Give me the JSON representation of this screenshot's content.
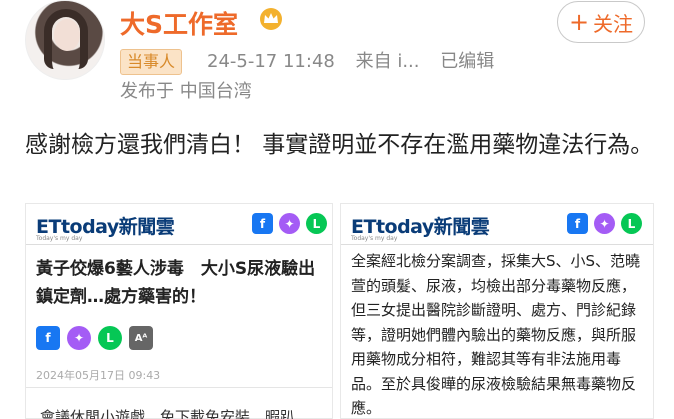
{
  "profile": {
    "username": "大S工作室",
    "follow_label": "关注",
    "badge": "当事人",
    "timestamp": "24-5-17 11:48",
    "source": "来自 i...",
    "edited": "已编辑",
    "location": "发布于 中国台湾"
  },
  "post": {
    "text": "感謝檢方還我們清白！ 事實證明並不存在濫用藥物違法行為。"
  },
  "card_left": {
    "brand": "ETtoday新聞雲",
    "tagline": "Today's my day",
    "headline": "黃子佼爆6藝人涉毒　大小S尿液驗出鎮定劑…處方藥害的！",
    "date": "2024年05月17日 09:43",
    "cut_text": "會議休閒小遊戲　免下載免安裝　暇趴",
    "font_button": "Aᴬ"
  },
  "card_right": {
    "brand": "ETtoday新聞雲",
    "tagline": "Today's my day",
    "body": "全案經北檢分案調查，採集大S、小S、范曉萱的頭髮、尿液，均檢出部分毒藥物反應，但三女提出醫院診斷證明、處方、門診紀錄等，證明她們體內驗出的藥物反應，與所服用藥物成分相符，難認其等有非法施用毒品。至於具俊曄的尿液檢驗結果無毒藥物反應。"
  },
  "colors": {
    "username": "#ee6a2a",
    "badge_bg": "#fbe3c6",
    "facebook": "#1877f2",
    "messenger": "#a45cf5",
    "line": "#06c755"
  }
}
